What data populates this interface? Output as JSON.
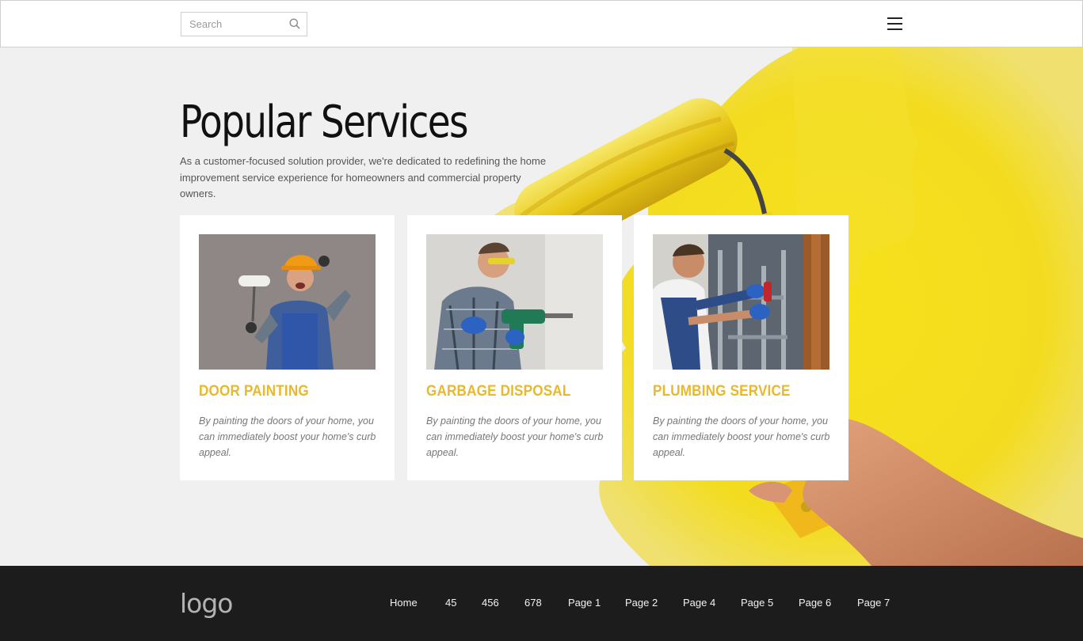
{
  "header": {
    "search_placeholder": "Search"
  },
  "hero": {
    "title": "Popular Services",
    "intro": "As a customer-focused solution provider, we're dedicated to redefining the home improvement service experience for homeowners and commercial property owners."
  },
  "services": [
    {
      "title": "DOOR PAINTING",
      "description": "By painting the doors of your home, you can immediately boost your home's curb appeal."
    },
    {
      "title": "GARBAGE DISPOSAL",
      "description": "By painting the doors of your home, you can immediately boost your home's curb appeal."
    },
    {
      "title": "PLUMBING SERVICE",
      "description": "By painting the doors of your home, you can immediately boost your home's curb appeal."
    }
  ],
  "footer": {
    "logo": "logo",
    "nav": [
      "Home",
      "45",
      "456",
      "678",
      "Page 1",
      "Page 2",
      "Page 4",
      "Page 5",
      "Page 6",
      "Page 7"
    ]
  },
  "colors": {
    "accent": "#e9b82c",
    "paint_yellow": "#f3de1b",
    "footer_bg": "#1c1c1c"
  },
  "icons": {
    "search": "search-icon",
    "menu": "hamburger-menu-icon"
  }
}
